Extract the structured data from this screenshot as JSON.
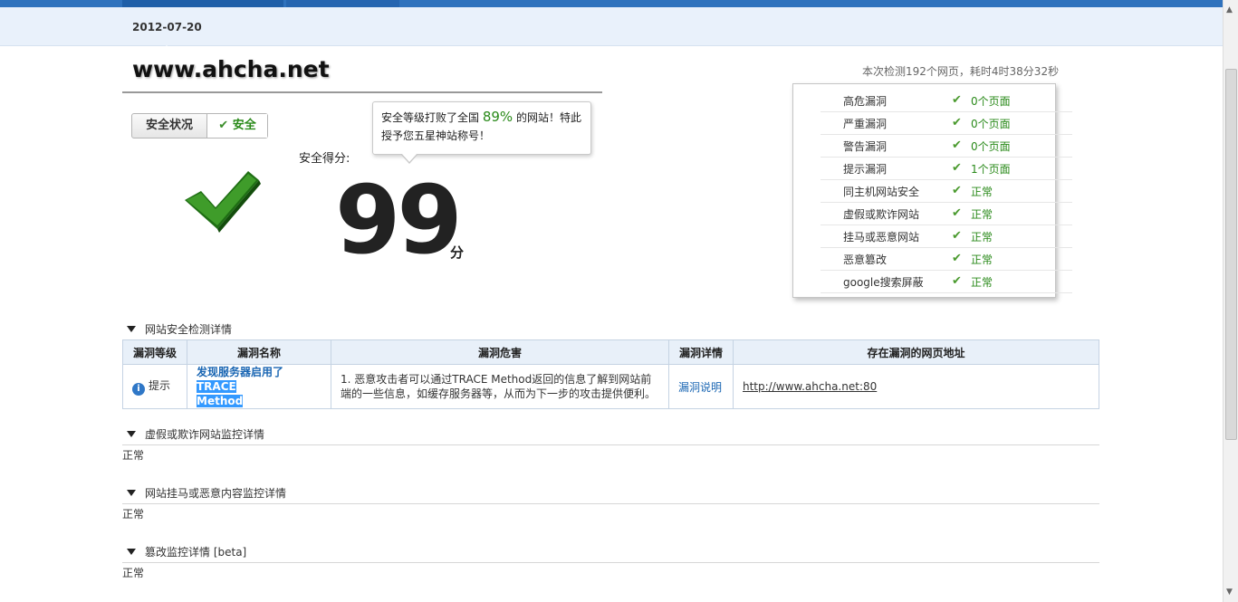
{
  "header": {
    "date": "2012-07-20"
  },
  "site": {
    "domain": "www.ahcha.net"
  },
  "status": {
    "label": "安全状况",
    "value": "安全",
    "check_icon": "check-icon"
  },
  "bubble": {
    "text_pre": "安全等级打败了全国",
    "percent": "89%",
    "text_post": "的网站！特此授予您五星神站称号！"
  },
  "score": {
    "label": "安全得分:",
    "value": "99",
    "unit": "分"
  },
  "scan_info": "本次检测192个网页，耗时4时38分32秒",
  "summary": [
    {
      "name": "高危漏洞",
      "status": "0个页面"
    },
    {
      "name": "严重漏洞",
      "status": "0个页面"
    },
    {
      "name": "警告漏洞",
      "status": "0个页面"
    },
    {
      "name": "提示漏洞",
      "status": "1个页面"
    },
    {
      "name": "同主机网站安全",
      "status": "正常"
    },
    {
      "name": "虚假或欺诈网站",
      "status": "正常"
    },
    {
      "name": "挂马或恶意网站",
      "status": "正常"
    },
    {
      "name": "恶意篡改",
      "status": "正常"
    },
    {
      "name": "google搜索屏蔽",
      "status": "正常"
    }
  ],
  "vuln_section": {
    "title": "网站安全检测详情",
    "headers": [
      "漏洞等级",
      "漏洞名称",
      "漏洞危害",
      "漏洞详情",
      "存在漏洞的网页地址"
    ],
    "row": {
      "level": "提示",
      "name_plain": "发现服务器启用了",
      "name_hl1": "TRACE",
      "name_hl2": "Method",
      "harm": "1. 恶意攻击者可以通过TRACE Method返回的信息了解到网站前端的一些信息，如缓存服务器等，从而为下一步的攻击提供便利。",
      "detail": "漏洞说明",
      "url": "http://www.ahcha.net:80"
    }
  },
  "sections": [
    {
      "title": "虚假或欺诈网站监控详情",
      "body": "正常"
    },
    {
      "title": "网站挂马或恶意内容监控详情",
      "body": "正常"
    },
    {
      "title": "篡改监控详情 [beta]",
      "body": "正常"
    }
  ],
  "colors": {
    "accent": "#2f72bd",
    "ok_green": "#2a8a1a",
    "link": "#1a66b3"
  }
}
